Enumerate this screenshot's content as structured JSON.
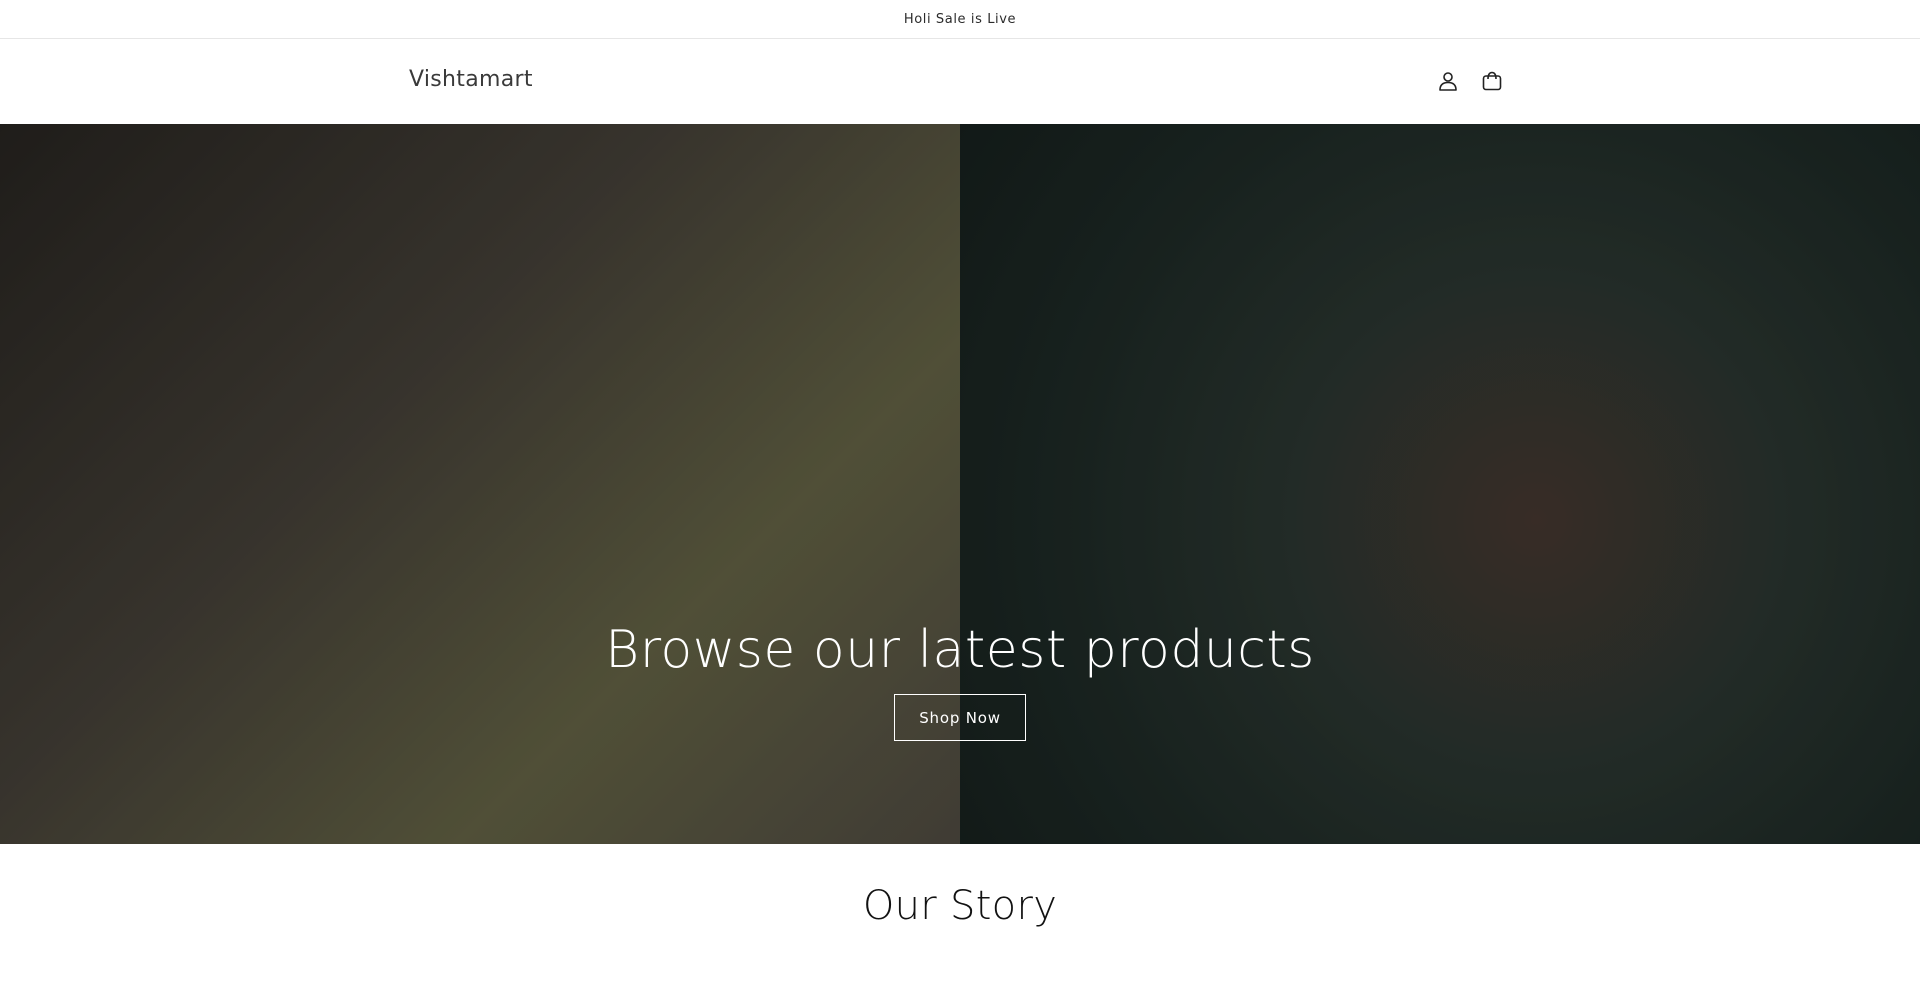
{
  "announcement": {
    "text": "Holi Sale is Live"
  },
  "header": {
    "logo": "Vishtamart",
    "icons": {
      "account": "user-icon",
      "cart": "cart-icon"
    }
  },
  "hero": {
    "title": "Browse our latest products",
    "button_label": "Shop Now"
  },
  "story": {
    "title": "Our Story"
  }
}
